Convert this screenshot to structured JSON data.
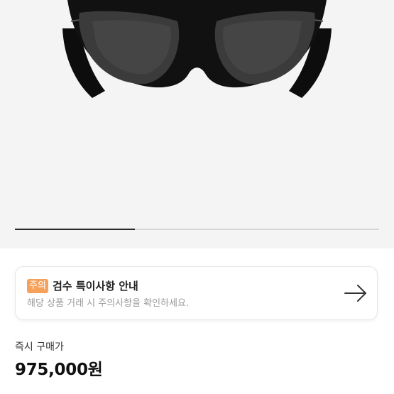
{
  "product": {
    "image_icon": "sunglasses-icon",
    "carousel_progress": 0.33
  },
  "notice": {
    "badge": "주의",
    "title": "검수 특이사항 안내",
    "description": "해당 상품 거래 시 주의사항을 확인하세요.",
    "arrow_icon": "arrow-right-icon",
    "badge_color": "#f6a15a"
  },
  "price": {
    "label": "즉시 구매가",
    "value": "975,000원"
  }
}
